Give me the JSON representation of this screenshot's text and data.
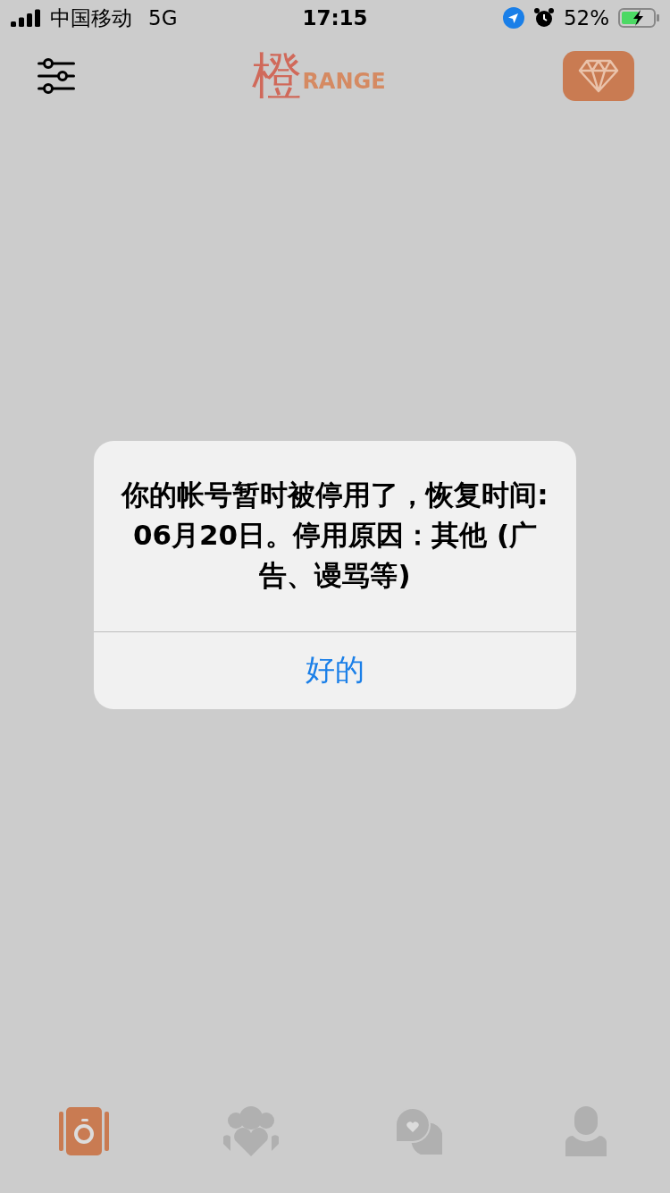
{
  "status_bar": {
    "carrier": "中国移动",
    "network": "5G",
    "time": "17:15",
    "battery": "52%"
  },
  "header": {
    "logo_mark": "橙",
    "logo_text": "RANGE"
  },
  "alert": {
    "message": "你的帐号暂时被停用了，恢复时间: 06月20日。停用原因：其他 (广告、谩骂等)",
    "button": "好的"
  },
  "tabs": [
    {
      "kind": "cards",
      "selected": true
    },
    {
      "kind": "group",
      "selected": false
    },
    {
      "kind": "chat",
      "selected": false
    },
    {
      "kind": "profile",
      "selected": false
    }
  ]
}
